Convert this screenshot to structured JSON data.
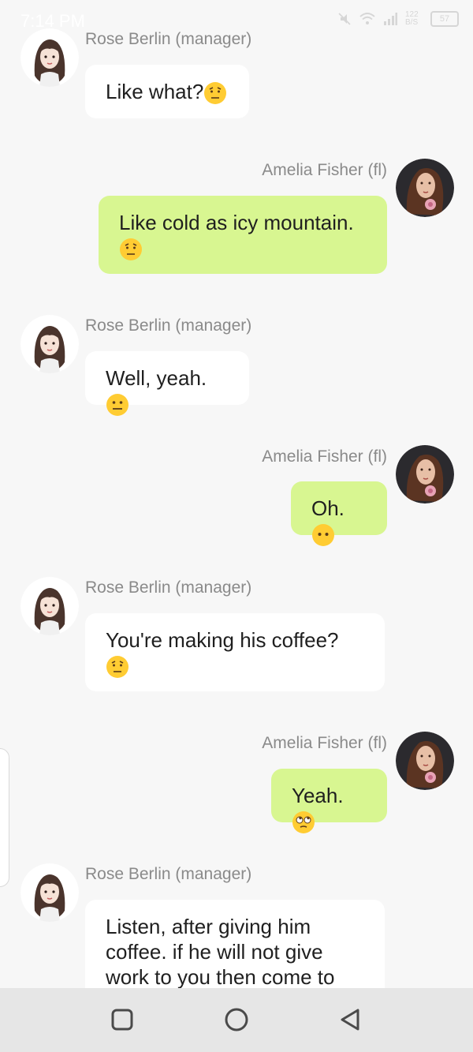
{
  "status_bar": {
    "time": "7:14 PM",
    "icons": [
      "mute-icon",
      "wifi-icon",
      "signal-icon",
      "data-speed-icon",
      "battery-icon"
    ],
    "data_speed": "122 B/S",
    "battery": "57"
  },
  "colors": {
    "background": "#f7f7f7",
    "incoming_bubble": "#ffffff",
    "outgoing_bubble": "#d8f691",
    "name_text": "#8a8a8a",
    "message_text": "#1f1f1f"
  },
  "messages": [
    {
      "sender": "Rose Berlin (manager)",
      "side": "left",
      "text": "Like what?",
      "emoji": "raised-eyebrow-emoji"
    },
    {
      "sender": "Amelia Fisher (fl)",
      "side": "right",
      "text": "Like cold as icy mountain.",
      "emoji": "raised-eyebrow-emoji"
    },
    {
      "sender": "Rose Berlin (manager)",
      "side": "left",
      "text": "Well, yeah.",
      "emoji": "neutral-face-emoji"
    },
    {
      "sender": "Amelia Fisher (fl)",
      "side": "right",
      "text": "Oh.",
      "emoji": "no-mouth-face-emoji"
    },
    {
      "sender": "Rose Berlin (manager)",
      "side": "left",
      "text": "You're making his coffee?",
      "emoji": "raised-eyebrow-emoji"
    },
    {
      "sender": "Amelia Fisher (fl)",
      "side": "right",
      "text": "Yeah.",
      "emoji": "eye-roll-emoji"
    },
    {
      "sender": "Rose Berlin (manager)",
      "side": "left",
      "text": "Listen, after giving him coffee. if he will not give work to you then come to",
      "emoji": ""
    }
  ],
  "nav_bar": {
    "buttons": [
      "recents-square-icon",
      "home-circle-icon",
      "back-triangle-icon"
    ]
  }
}
